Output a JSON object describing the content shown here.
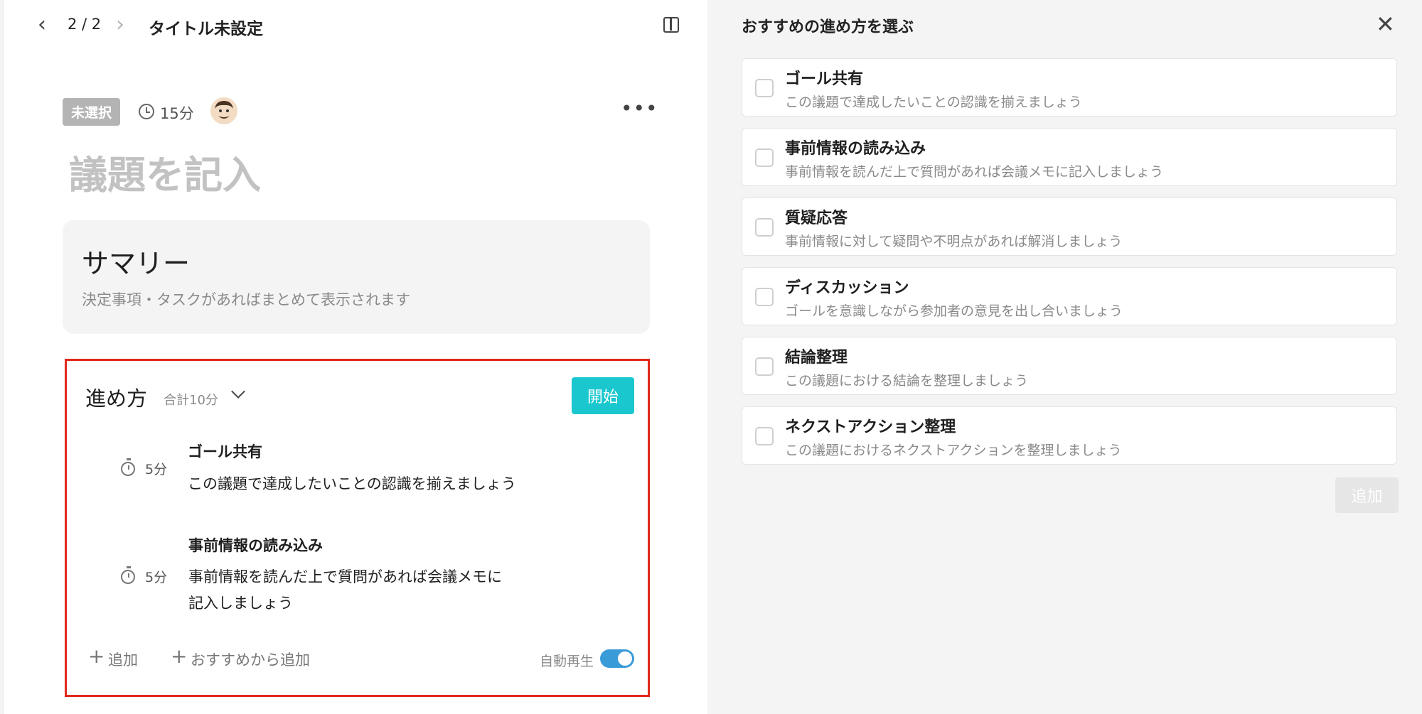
{
  "header": {
    "prev_icon": "chevron-left-icon",
    "pager": "2 / 2",
    "next_icon": "chevron-right-icon",
    "doc_title": "タイトル未設定",
    "panel_toggle_icon": "split-panel-icon"
  },
  "agenda": {
    "status_badge": "未選択",
    "duration": "15分",
    "title_placeholder": "議題を記入",
    "more_icon": "more-dots-icon"
  },
  "summary": {
    "title": "サマリー",
    "text": "決定事項・タスクがあればまとめて表示されます"
  },
  "method": {
    "title": "進め方",
    "total": "合計10分",
    "start_label": "開始",
    "steps": [
      {
        "time": "5分",
        "title": "ゴール共有",
        "desc_line1": "この議題で達成したいことの認識を揃えましょう",
        "desc_line2": ""
      },
      {
        "time": "5分",
        "title": "事前情報の読み込み",
        "desc_line1": "事前情報を読んだ上で質問があれば会議メモに",
        "desc_line2": "記入しましょう"
      }
    ],
    "add_label": "追加",
    "add_recommended_label": "おすすめから追加",
    "autoplay_label": "自動再生",
    "autoplay_on": true
  },
  "panel": {
    "title": "おすすめの進め方を選ぶ",
    "close_icon": "close-icon",
    "items": [
      {
        "title": "ゴール共有",
        "desc": "この議題で達成したいことの認識を揃えましょう"
      },
      {
        "title": "事前情報の読み込み",
        "desc": "事前情報を読んだ上で質問があれば会議メモに記入しましょう"
      },
      {
        "title": "質疑応答",
        "desc": "事前情報に対して疑問や不明点があれば解消しましょう"
      },
      {
        "title": "ディスカッション",
        "desc": "ゴールを意識しながら参加者の意見を出し合いましょう"
      },
      {
        "title": "結論整理",
        "desc": "この議題における結論を整理しましょう"
      },
      {
        "title": "ネクストアクション整理",
        "desc": "この議題におけるネクストアクションを整理しましょう"
      }
    ],
    "add_button": "追加"
  },
  "colors": {
    "accent": "#1ac7cf",
    "highlight_border": "#e1281b",
    "toggle": "#3a9bd9"
  }
}
